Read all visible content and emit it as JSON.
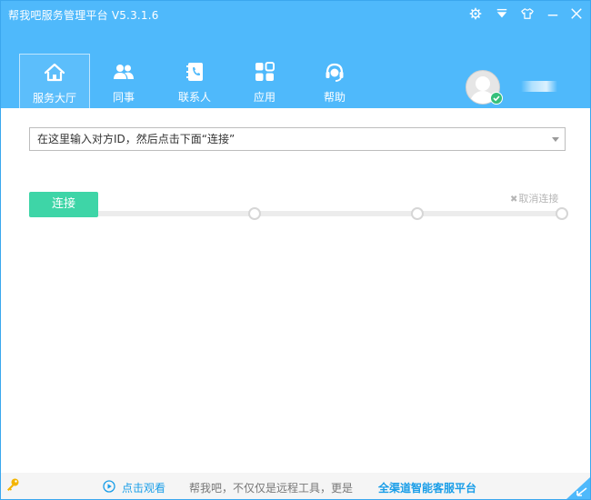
{
  "window": {
    "title": "帮我吧服务管理平台 V5.3.1.6",
    "controls": [
      "settings-icon",
      "dropdown-menu-icon",
      "skin-icon",
      "minimize-icon",
      "close-icon"
    ]
  },
  "nav": {
    "tabs": [
      {
        "label": "服务大厅",
        "icon": "home-icon",
        "active": true
      },
      {
        "label": "同事",
        "icon": "colleagues-icon",
        "active": false
      },
      {
        "label": "联系人",
        "icon": "contacts-book-icon",
        "active": false
      },
      {
        "label": "应用",
        "icon": "apps-grid-icon",
        "active": false
      },
      {
        "label": "帮助",
        "icon": "help-headset-icon",
        "active": false
      }
    ]
  },
  "user": {
    "status": "online"
  },
  "connect_panel": {
    "input_placeholder": "在这里输入对方ID，然后点击下面“连接”",
    "connect_label": "连接",
    "cancel_label": "取消连接",
    "progress": 0
  },
  "footer": {
    "watch_label": "点击观看",
    "tagline": "帮我吧，不仅仅是远程工具，更是",
    "tagline_strong": "全渠道智能客服平台"
  },
  "colors": {
    "header": "#4fb9fb",
    "connect_button": "#3ed5a7",
    "link": "#1a9ee8",
    "online": "#36c07b"
  }
}
